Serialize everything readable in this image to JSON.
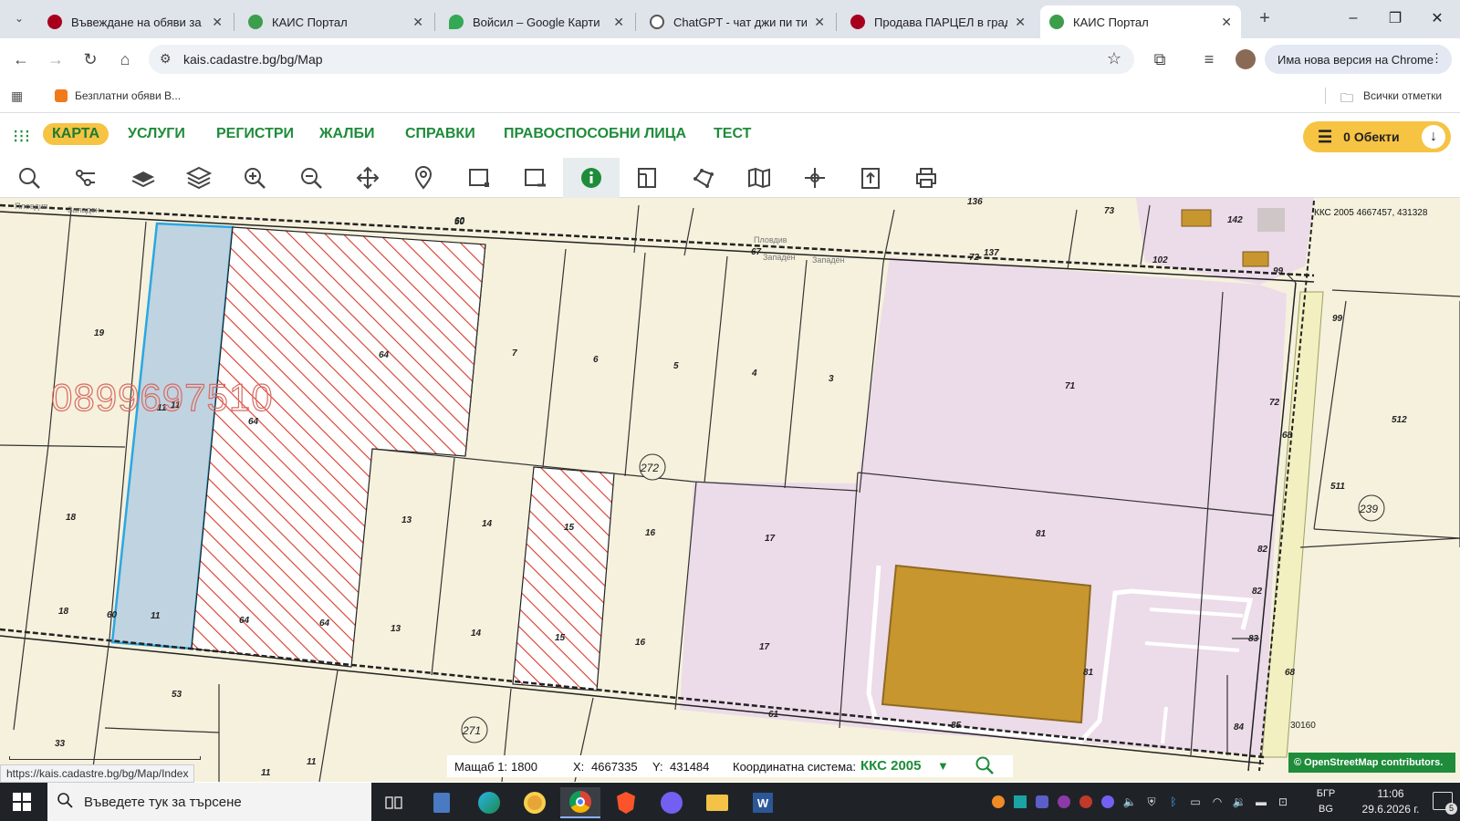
{
  "browser": {
    "tabs": [
      {
        "title": "Въвеждане на обяви за П",
        "favicon_color": "#a8001c"
      },
      {
        "title": "КАИС Портал",
        "favicon_color": "#3c9d4b"
      },
      {
        "title": "Войсил – Google Карти",
        "favicon_color": "#34a853"
      },
      {
        "title": "ChatGPT - чат джи пи ти",
        "favicon_color": "#555555"
      },
      {
        "title": "Продава ПАРЦЕЛ в град",
        "favicon_color": "#a8001c"
      },
      {
        "title": "КАИС Портал",
        "favicon_color": "#3c9d4b"
      }
    ],
    "url": "kais.cadastre.bg/bg/Map",
    "update_label": "Има нова версия на Chrome",
    "bookmark": "Безплатни обяви В...",
    "all_bookmarks": "Всички отметки",
    "hover_url": "https://kais.cadastre.bg/bg/Map/Index"
  },
  "app_nav": {
    "items": [
      "КАРТА",
      "УСЛУГИ",
      "РЕГИСТРИ",
      "ЖАЛБИ",
      "СПРАВКИ",
      "ПРАВОСПОСОБНИ ЛИЦА",
      "ТЕСТ"
    ],
    "objects_label": "0 Обекти"
  },
  "toolbar": {
    "tools": [
      "search-icon",
      "tree-icon",
      "layer-icon",
      "layers-icon",
      "zoom-in-icon",
      "zoom-out-icon",
      "pan-icon",
      "pin-icon",
      "select-rect-icon",
      "deselect-rect-icon",
      "info-icon",
      "measure-icon",
      "polygon-icon",
      "map-icon",
      "coordinates-icon",
      "export-icon",
      "print-icon"
    ]
  },
  "map": {
    "coord_label": "ККС 2005 4667457, 431328",
    "phone_watermark": "0899697510",
    "road_labels": [
      "Пловдив",
      "Западен",
      "Пловдив",
      "Западен",
      "Западен"
    ],
    "circle_labels": [
      "272",
      "271",
      "239"
    ],
    "parcel_labels": [
      "19",
      "18",
      "18",
      "11",
      "11",
      "11",
      "64",
      "64",
      "64",
      "64",
      "60",
      "7",
      "6",
      "5",
      "4",
      "3",
      "13",
      "13",
      "14",
      "14",
      "15",
      "15",
      "16",
      "16",
      "17",
      "17",
      "71",
      "72",
      "81",
      "81",
      "82",
      "82",
      "83",
      "84",
      "85",
      "61",
      "53",
      "33",
      "11",
      "11",
      "50",
      "67",
      "72",
      "137",
      "73",
      "136",
      "142",
      "102",
      "99",
      "99",
      "512",
      "511",
      "60",
      "68",
      "30160",
      "68"
    ],
    "colors": {
      "background": "#f5f1dd",
      "pink": "#ecdbe8",
      "blue": "#c0d3e0",
      "red_hatch": "#d93a2b",
      "building": "#c8962e",
      "road": "#f2efc0"
    }
  },
  "status": {
    "scale_label": "Мащаб 1:",
    "scale_value": "1800",
    "x_label": "X:",
    "x_value": "4667335",
    "y_label": "Y:",
    "y_value": "431484",
    "crs_label": "Координатна система:",
    "crs_value": "ККС 2005",
    "osm_label": "© OpenStreetMap contributors."
  },
  "taskbar": {
    "search_placeholder": "Въведете тук за търсене",
    "lang": "БГР",
    "lang2": "BG",
    "time": "11:06",
    "date": "29.6.2026 г.",
    "notification_count": "5"
  }
}
